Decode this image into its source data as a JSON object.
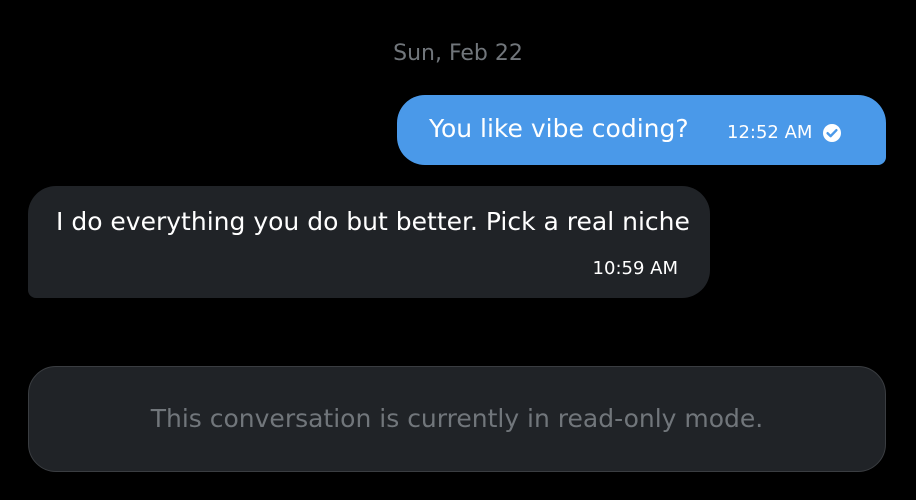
{
  "conversation": {
    "date_separator": "Sun, Feb 22",
    "messages": [
      {
        "direction": "sent",
        "text": "You like vibe coding?",
        "time": "12:52 AM",
        "status_icon": "check-circle-icon"
      },
      {
        "direction": "received",
        "text": "I do everything you do but better. Pick a real niche",
        "time": "10:59 AM"
      }
    ],
    "read_only_notice": "This conversation is currently in read-only mode."
  },
  "colors": {
    "background": "#000000",
    "sent_bubble": "#4a99e9",
    "received_bubble": "#202327",
    "muted_text": "#71767b",
    "text": "#ffffff"
  }
}
